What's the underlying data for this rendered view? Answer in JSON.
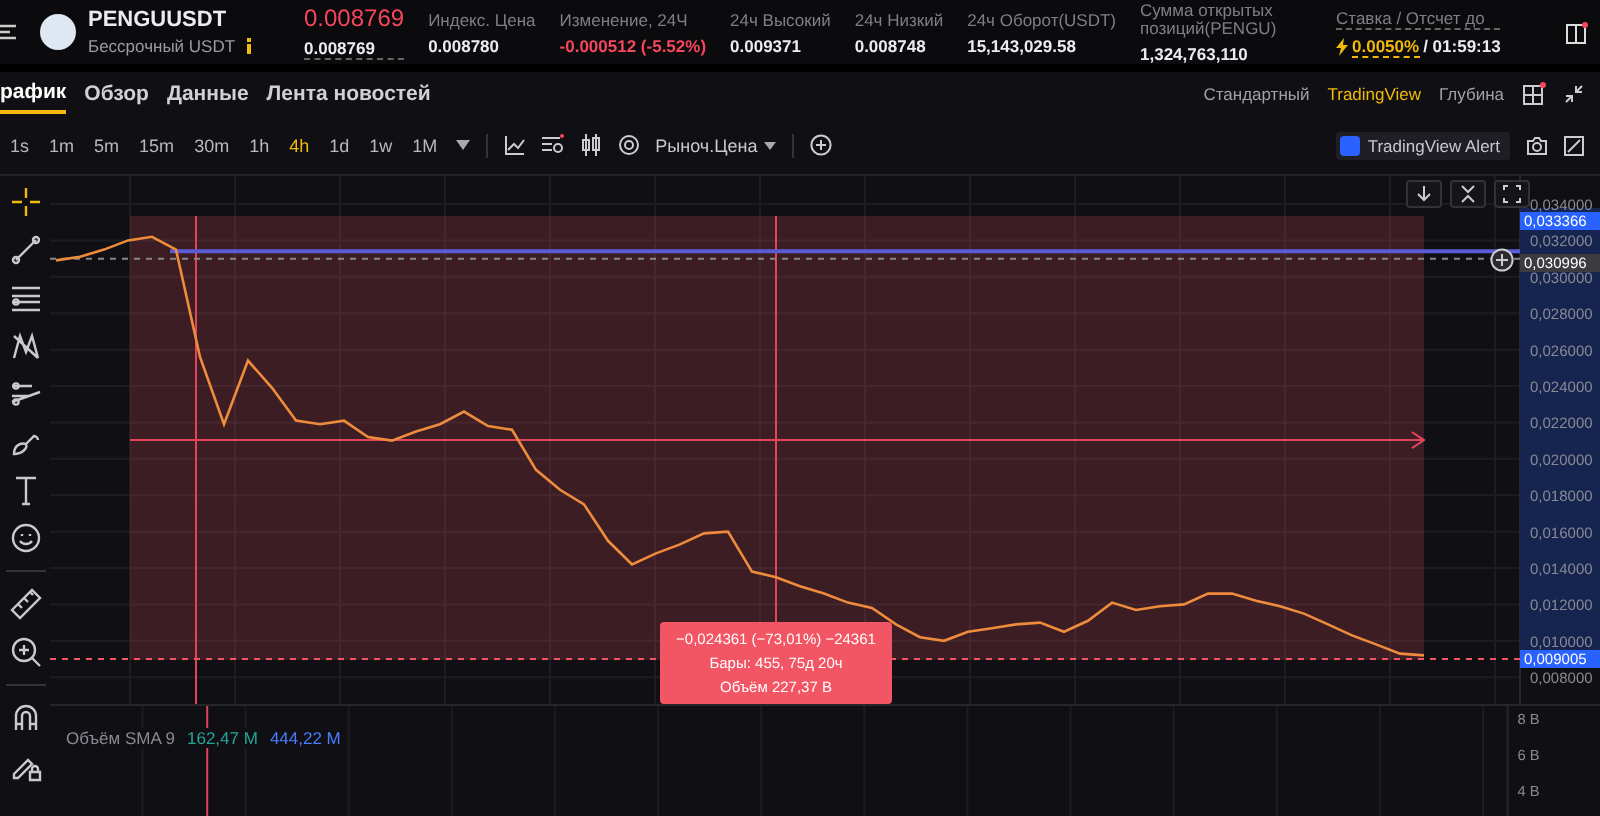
{
  "header": {
    "symbol": "PENGUUSDT",
    "contract": "Бессрочный USDT",
    "last_price": "0.008769",
    "mark_price": "0.008769",
    "stats": [
      {
        "label": "Индекс. Цена",
        "value": "0.008780",
        "color": "#eaecef"
      },
      {
        "label": "Изменение, 24Ч",
        "value": "-0.000512 (-5.52%)",
        "color": "#f6465d"
      },
      {
        "label": "24ч Высокий",
        "value": "0.009371",
        "color": "#eaecef"
      },
      {
        "label": "24ч Низкий",
        "value": "0.008748",
        "color": "#eaecef"
      },
      {
        "label": "24ч Оборот(USDT)",
        "value": "15,143,029.58",
        "color": "#eaecef"
      },
      {
        "label": "Сумма открытых позиций(PENGU)",
        "value": "1,324,763,110",
        "color": "#eaecef"
      }
    ],
    "funding": {
      "label": "Ставка / Отсчет до",
      "rate": "0.0050%",
      "countdown": "/ 01:59:13"
    }
  },
  "tabs": [
    {
      "label": "рафик",
      "selected": true
    },
    {
      "label": "Обзор",
      "selected": false
    },
    {
      "label": "Данные",
      "selected": false
    },
    {
      "label": "Лента новостей",
      "selected": false
    }
  ],
  "views": [
    {
      "label": "Стандартный",
      "selected": false
    },
    {
      "label": "TradingView",
      "selected": true
    },
    {
      "label": "Глубина",
      "selected": false
    }
  ],
  "intervals": [
    {
      "label": "1s",
      "selected": false
    },
    {
      "label": "1m",
      "selected": false
    },
    {
      "label": "5m",
      "selected": false
    },
    {
      "label": "15m",
      "selected": false
    },
    {
      "label": "30m",
      "selected": false
    },
    {
      "label": "1h",
      "selected": false
    },
    {
      "label": "4h",
      "selected": true
    },
    {
      "label": "1d",
      "selected": false
    },
    {
      "label": "1w",
      "selected": false
    },
    {
      "label": "1M",
      "selected": false
    }
  ],
  "price_type": "Рыноч.Цена",
  "alert_button": "TradingView Alert",
  "tools": [
    {
      "kind": "crosshair",
      "selected": true
    },
    {
      "kind": "trendline",
      "selected": false
    },
    {
      "kind": "fib",
      "selected": false
    },
    {
      "kind": "pattern",
      "selected": false
    },
    {
      "kind": "projection",
      "selected": false
    },
    {
      "kind": "brush",
      "selected": false
    },
    {
      "kind": "text",
      "selected": false
    },
    {
      "kind": "emoji",
      "selected": false
    },
    {
      "kind": "ruler",
      "selected": false
    },
    {
      "kind": "zoom",
      "selected": false
    },
    {
      "kind": "magnet",
      "selected": false
    },
    {
      "kind": "lock",
      "selected": false
    }
  ],
  "chart": {
    "chart_data": {
      "type": "line",
      "ylim": [
        0.00653,
        0.03554
      ],
      "grid": true,
      "ref_lines": [
        {
          "axis": "y",
          "value": 0.0314,
          "color": "#5b5bd6"
        },
        {
          "axis": "y",
          "value": 0.030996,
          "color": "#888888"
        },
        {
          "axis": "y",
          "value": 0.02103,
          "color": "#e0455a"
        },
        {
          "axis": "y",
          "value": 0.009005,
          "color": "#f25563"
        }
      ],
      "yticks": [
        {
          "value": 0.034,
          "label": "0,034000"
        },
        {
          "value": 0.032,
          "label": "0,032000"
        },
        {
          "value": 0.03,
          "label": "0,030000"
        },
        {
          "value": 0.028,
          "label": "0,028000"
        },
        {
          "value": 0.026,
          "label": "0,026000"
        },
        {
          "value": 0.024,
          "label": "0,024000"
        },
        {
          "value": 0.022,
          "label": "0,022000"
        },
        {
          "value": 0.02,
          "label": "0,020000"
        },
        {
          "value": 0.018,
          "label": "0,018000"
        },
        {
          "value": 0.016,
          "label": "0,016000"
        },
        {
          "value": 0.014,
          "label": "0,014000"
        },
        {
          "value": 0.012,
          "label": "0,012000"
        },
        {
          "value": 0.01,
          "label": "0,010000"
        },
        {
          "value": 0.008,
          "label": "0,008000"
        }
      ],
      "values": [
        0.0309,
        0.0311,
        0.0315,
        0.032,
        0.0322,
        0.0315,
        0.0256,
        0.0219,
        0.0254,
        0.0239,
        0.0221,
        0.0219,
        0.0221,
        0.0212,
        0.021,
        0.0215,
        0.0219,
        0.0226,
        0.0218,
        0.0216,
        0.0194,
        0.0183,
        0.0175,
        0.0155,
        0.0142,
        0.0148,
        0.0153,
        0.0159,
        0.016,
        0.0138,
        0.0135,
        0.013,
        0.0126,
        0.0121,
        0.0118,
        0.0109,
        0.0102,
        0.01,
        0.0105,
        0.0107,
        0.0109,
        0.011,
        0.0105,
        0.0111,
        0.0121,
        0.0117,
        0.0119,
        0.012,
        0.0126,
        0.0126,
        0.0122,
        0.0119,
        0.0115,
        0.0109,
        0.0103,
        0.0098,
        0.0093,
        0.0092
      ]
    },
    "volume_axis": [
      "8 B",
      "6 B",
      "4 B"
    ],
    "price_tags": [
      {
        "label": "0,033366",
        "color": "#2962ff"
      },
      {
        "label": "0,030996",
        "color": "#3b3b40"
      },
      {
        "label": "0,009005",
        "color": "#2962ff"
      }
    ],
    "volume_legend": {
      "title": "Объём SMA 9",
      "sma": "162,47 M",
      "volume": "444,22 M"
    },
    "measure": {
      "change": "−0,024361 (−73,01%) −24361",
      "bars": "Бары: 455, 75д 20ч",
      "volume": "Объём 227,37 B"
    }
  }
}
